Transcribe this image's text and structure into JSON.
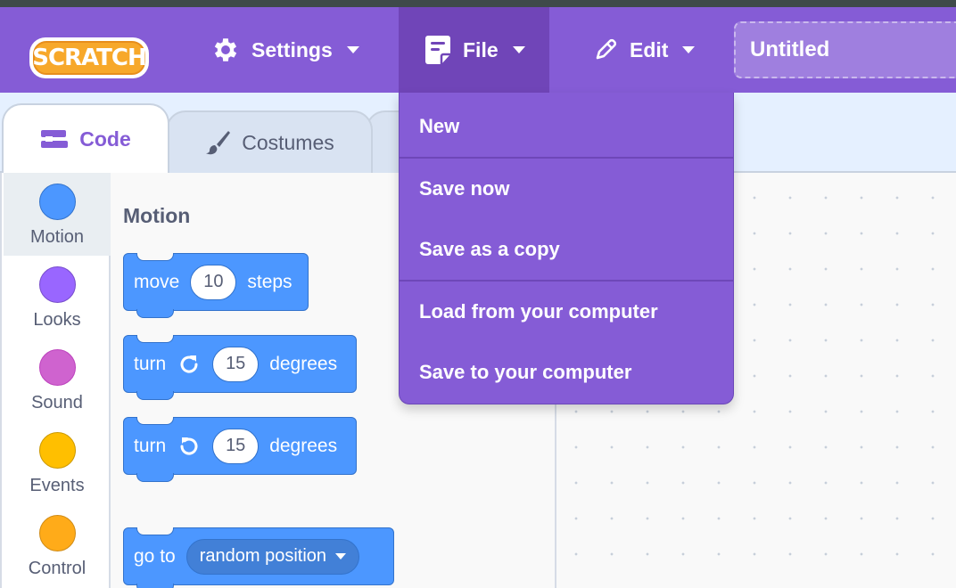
{
  "app": {
    "logo_text": "SCRATCH"
  },
  "menubar": {
    "settings_label": "Settings",
    "file_label": "File",
    "edit_label": "Edit",
    "project_title": "Untitled"
  },
  "file_menu": {
    "items": [
      "New",
      "Save now",
      "Save as a copy",
      "Load from your computer",
      "Save to your computer"
    ]
  },
  "tabs": {
    "code": "Code",
    "costumes": "Costumes"
  },
  "categories": [
    {
      "label": "Motion",
      "color": "#4c97ff"
    },
    {
      "label": "Looks",
      "color": "#9966ff"
    },
    {
      "label": "Sound",
      "color": "#cf63cf"
    },
    {
      "label": "Events",
      "color": "#ffbf00"
    },
    {
      "label": "Control",
      "color": "#ffab19"
    }
  ],
  "palette": {
    "heading": "Motion",
    "blocks": {
      "move": {
        "w1": "move",
        "value": "10",
        "w2": "steps"
      },
      "turn_right": {
        "w1": "turn",
        "value": "15",
        "w2": "degrees"
      },
      "turn_left": {
        "w1": "turn",
        "value": "15",
        "w2": "degrees"
      },
      "goto": {
        "w1": "go to",
        "menu": "random position"
      }
    }
  },
  "colors": {
    "menubar": "#855cd6",
    "menu_active": "#7045b8",
    "motion_block": "#4c97ff",
    "tab_strip": "#e5f0ff"
  }
}
